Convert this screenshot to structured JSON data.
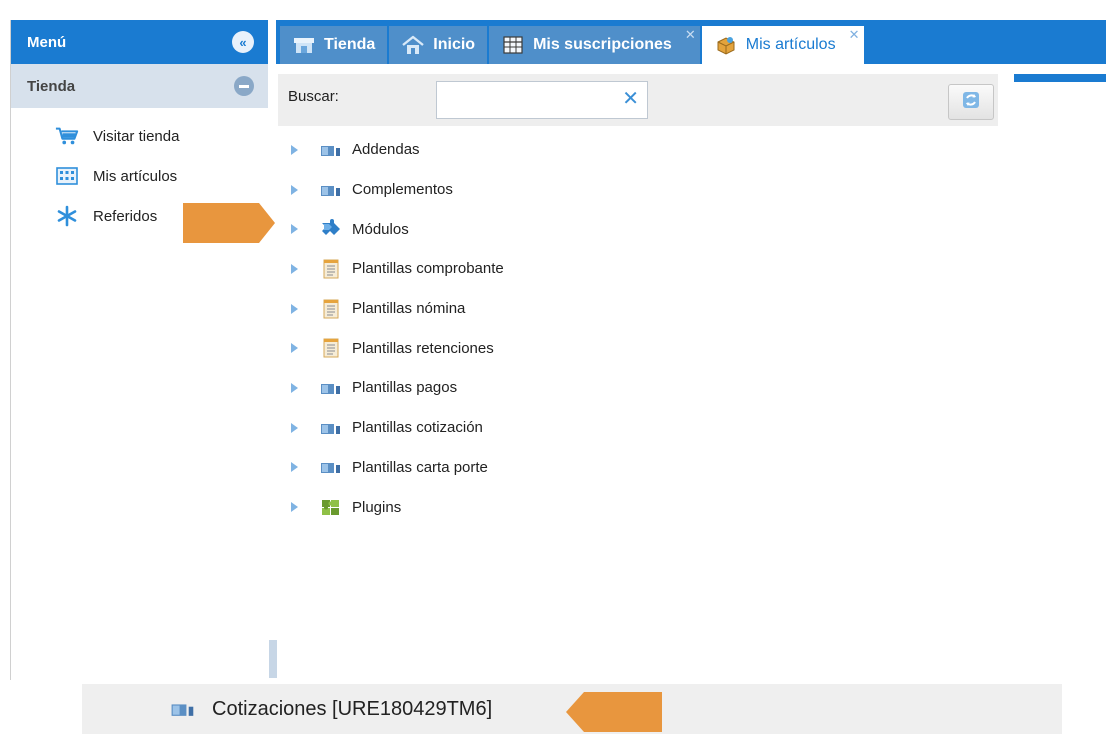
{
  "colors": {
    "brand_blue": "#1a7bd1",
    "section_bg": "#d7e1ec",
    "annotation_orange": "#e8963e"
  },
  "sidebar": {
    "title": "Menú",
    "collapse_icon": "double-chevron-left-icon",
    "section": {
      "title": "Tienda",
      "toggle_icon": "minus-circle-icon"
    },
    "items": [
      {
        "label": "Visitar tienda",
        "icon": "cart-icon"
      },
      {
        "label": "Mis artículos",
        "icon": "grid-icon"
      },
      {
        "label": "Referidos",
        "icon": "asterisk-icon"
      }
    ]
  },
  "tabs": [
    {
      "label": "Tienda",
      "icon": "store-icon",
      "active": false,
      "closable": false
    },
    {
      "label": "Inicio",
      "icon": "home-icon",
      "active": false,
      "closable": false
    },
    {
      "label": "Mis suscripciones",
      "icon": "table-icon",
      "active": false,
      "closable": true
    },
    {
      "label": "Mis artículos",
      "icon": "box-icon",
      "active": true,
      "closable": true
    }
  ],
  "search": {
    "label": "Buscar:",
    "value": "",
    "clear_icon": "clear-x-icon",
    "refresh_icon": "refresh-icon"
  },
  "tree": {
    "items": [
      {
        "label": "Addendas",
        "icon": "folder-blue-icon"
      },
      {
        "label": "Complementos",
        "icon": "folder-blue-icon"
      },
      {
        "label": "Módulos",
        "icon": "puzzle-blue-icon"
      },
      {
        "label": "Plantillas comprobante",
        "icon": "document-list-icon"
      },
      {
        "label": "Plantillas nómina",
        "icon": "document-list-icon"
      },
      {
        "label": "Plantillas retenciones",
        "icon": "document-list-icon"
      },
      {
        "label": "Plantillas pagos",
        "icon": "folder-blue-icon"
      },
      {
        "label": "Plantillas cotización",
        "icon": "folder-blue-icon"
      },
      {
        "label": "Plantillas carta porte",
        "icon": "folder-blue-icon"
      },
      {
        "label": "Plugins",
        "icon": "puzzle-green-icon"
      }
    ]
  },
  "inset": {
    "label": "Cotizaciones [URE180429TM6]",
    "icon": "folder-blue-icon"
  }
}
